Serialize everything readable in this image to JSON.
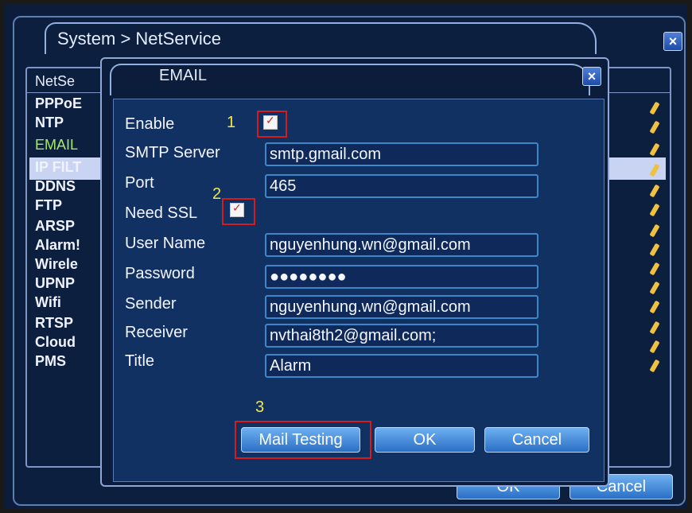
{
  "window": {
    "title": "System > NetService"
  },
  "list": {
    "header": "NetSe",
    "items": [
      "PPPoE",
      "NTP",
      "EMAIL",
      "IP FILT",
      "DDNS",
      "FTP",
      "ARSP",
      "Alarm!",
      "Wirele",
      "UPNP",
      "Wifi",
      "RTSP",
      "Cloud",
      "PMS"
    ],
    "selected": "EMAIL"
  },
  "dialog": {
    "title": "EMAIL",
    "enable": {
      "label": "Enable",
      "checked": true
    },
    "smtp_server": {
      "label": "SMTP Server",
      "value": "smtp.gmail.com"
    },
    "port": {
      "label": "Port",
      "value": "465"
    },
    "need_ssl": {
      "label": "Need SSL",
      "checked": true
    },
    "user_name": {
      "label": "User Name",
      "value": "nguyenhung.wn@gmail.com"
    },
    "password": {
      "label": "Password",
      "value": "●●●●●●●●"
    },
    "sender": {
      "label": "Sender",
      "value": "nguyenhung.wn@gmail.com"
    },
    "receiver": {
      "label": "Receiver",
      "value": "nvthai8th2@gmail.com;"
    },
    "title_field": {
      "label": "Title",
      "value": "Alarm"
    },
    "buttons": {
      "mail_testing": "Mail Testing",
      "ok": "OK",
      "cancel": "Cancel"
    }
  },
  "annotations": {
    "one": "1",
    "two": "2",
    "three": "3"
  },
  "outer_buttons": {
    "ok": "OK",
    "cancel": "Cancel"
  },
  "colors": {
    "highlight_red": "#d51c1c",
    "annotation_yellow": "#f4e64a",
    "selected_item": "#a6e86a"
  }
}
